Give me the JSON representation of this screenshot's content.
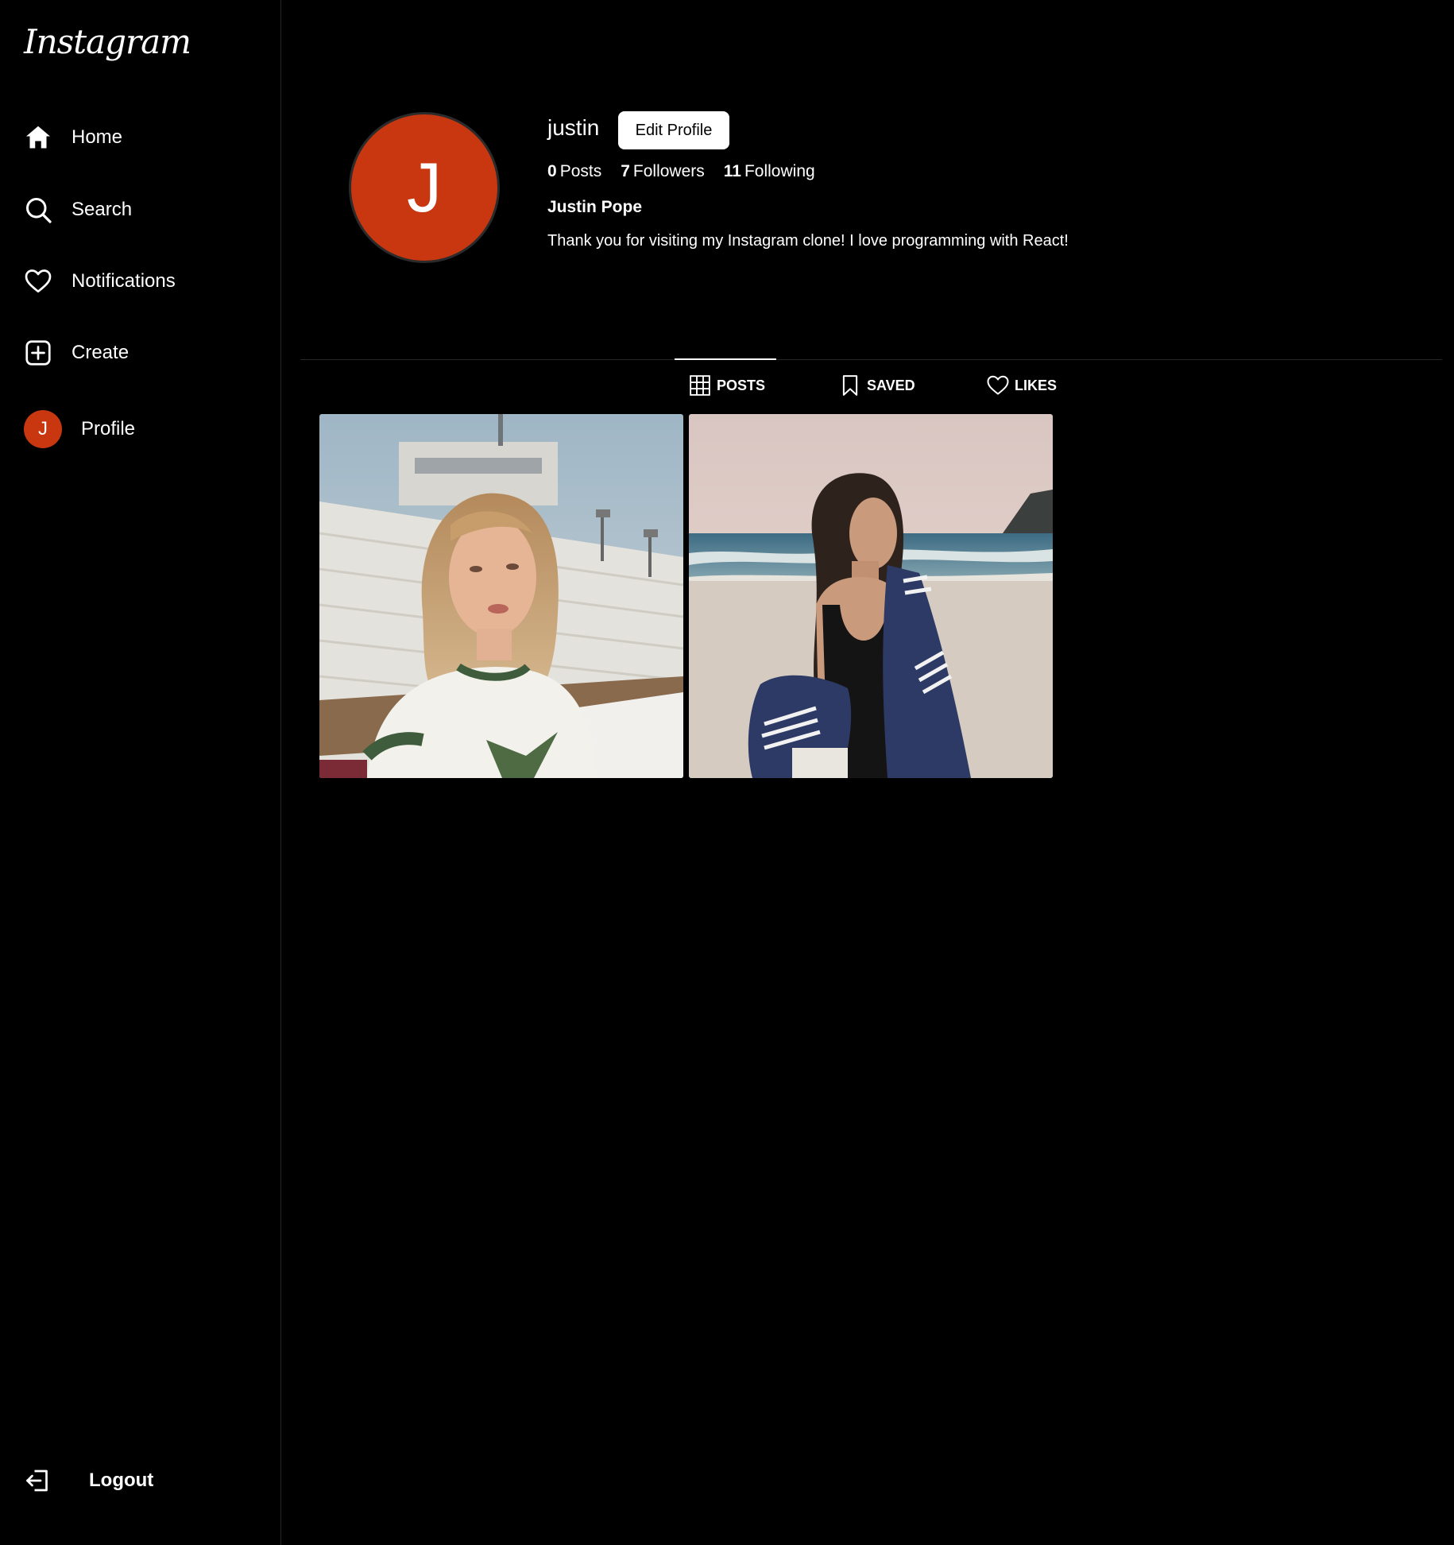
{
  "app": {
    "logo": "Instagram"
  },
  "sidebar": {
    "items": [
      {
        "label": "Home",
        "icon": "home-icon"
      },
      {
        "label": "Search",
        "icon": "search-icon"
      },
      {
        "label": "Notifications",
        "icon": "heart-icon"
      },
      {
        "label": "Create",
        "icon": "plus-square-icon"
      },
      {
        "label": "Profile",
        "icon": "avatar",
        "avatar_letter": "J"
      }
    ],
    "logout": {
      "label": "Logout",
      "icon": "logout-icon"
    }
  },
  "profile": {
    "avatar_letter": "J",
    "avatar_color": "#c8370f",
    "username": "justin",
    "edit_button": "Edit Profile",
    "stats": {
      "posts": {
        "count": "0",
        "label": "Posts"
      },
      "followers": {
        "count": "7",
        "label": "Followers"
      },
      "following": {
        "count": "11",
        "label": "Following"
      }
    },
    "full_name": "Justin Pope",
    "bio": "Thank you for visiting my Instagram clone! I love programming with React!"
  },
  "tabs": [
    {
      "label": "POSTS",
      "icon": "grid-icon",
      "active": true
    },
    {
      "label": "SAVED",
      "icon": "bookmark-icon",
      "active": false
    },
    {
      "label": "LIKES",
      "icon": "heart-icon",
      "active": false
    }
  ],
  "posts": [
    {
      "alt": "photo-woman-stadium"
    },
    {
      "alt": "photo-woman-beach"
    }
  ]
}
